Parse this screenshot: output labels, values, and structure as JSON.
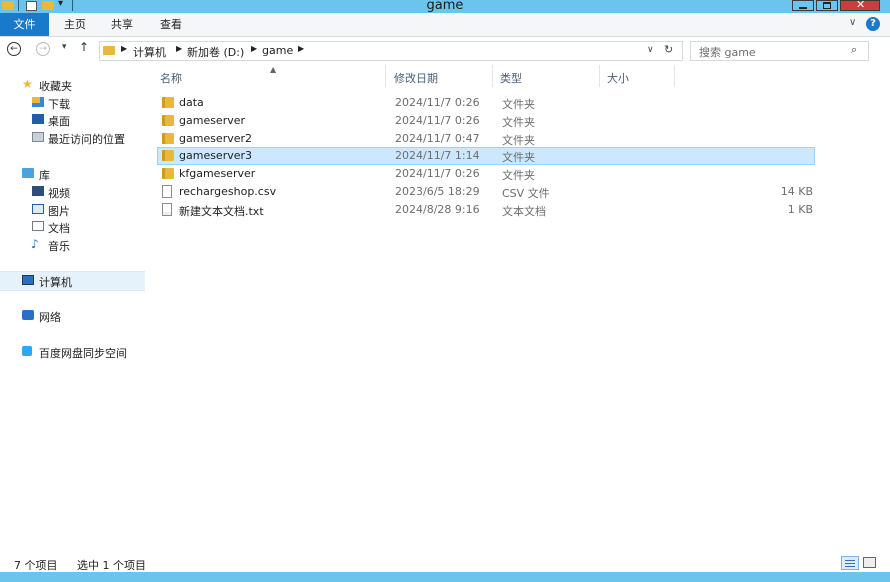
{
  "window": {
    "title": "game",
    "controls": {
      "minimize": "—",
      "maximize": "□",
      "close": "✕"
    }
  },
  "ribbon": {
    "tabs": [
      "文件",
      "主页",
      "共享",
      "查看"
    ],
    "expand_icon": "chevron-down-icon",
    "help_icon": "help-icon"
  },
  "address": {
    "breadcrumbs": [
      "计算机",
      "新加卷 (D:)",
      "game"
    ],
    "search_placeholder": "搜索 game"
  },
  "nav": {
    "items": [
      {
        "label": "收藏夹",
        "icon": "star-icon"
      },
      {
        "label": "下载",
        "icon": "downloads-icon"
      },
      {
        "label": "桌面",
        "icon": "desktop-icon"
      },
      {
        "label": "最近访问的位置",
        "icon": "recent-icon"
      },
      {
        "label": "库",
        "icon": "library-icon"
      },
      {
        "label": "视频",
        "icon": "video-icon"
      },
      {
        "label": "图片",
        "icon": "pictures-icon"
      },
      {
        "label": "文档",
        "icon": "documents-icon"
      },
      {
        "label": "音乐",
        "icon": "music-icon"
      },
      {
        "label": "计算机",
        "icon": "computer-icon"
      },
      {
        "label": "网络",
        "icon": "network-icon"
      },
      {
        "label": "百度网盘同步空间",
        "icon": "baidu-netdisk-icon"
      }
    ]
  },
  "columns": {
    "name": "名称",
    "date": "修改日期",
    "type": "类型",
    "size": "大小"
  },
  "files": [
    {
      "name": "data",
      "date": "2024/11/7 0:26",
      "type": "文件夹",
      "size": "",
      "icon": "folder-icon"
    },
    {
      "name": "gameserver",
      "date": "2024/11/7 0:26",
      "type": "文件夹",
      "size": "",
      "icon": "folder-icon"
    },
    {
      "name": "gameserver2",
      "date": "2024/11/7 0:47",
      "type": "文件夹",
      "size": "",
      "icon": "folder-icon"
    },
    {
      "name": "gameserver3",
      "date": "2024/11/7 1:14",
      "type": "文件夹",
      "size": "",
      "icon": "folder-icon",
      "selected": true
    },
    {
      "name": "kfgameserver",
      "date": "2024/11/7 0:26",
      "type": "文件夹",
      "size": "",
      "icon": "folder-icon"
    },
    {
      "name": "rechargeshop.csv",
      "date": "2023/6/5 18:29",
      "type": "CSV 文件",
      "size": "14 KB",
      "icon": "file-icon"
    },
    {
      "name": "新建文本文档.txt",
      "date": "2024/8/28 9:16",
      "type": "文本文档",
      "size": "1 KB",
      "icon": "text-file-icon"
    }
  ],
  "status": {
    "item_count": "7 个项目",
    "selection": "选中 1 个项目"
  },
  "colors": {
    "accent": "#1979ca",
    "titlebar": "#6ac4ec",
    "selection": "#cce8ff"
  }
}
